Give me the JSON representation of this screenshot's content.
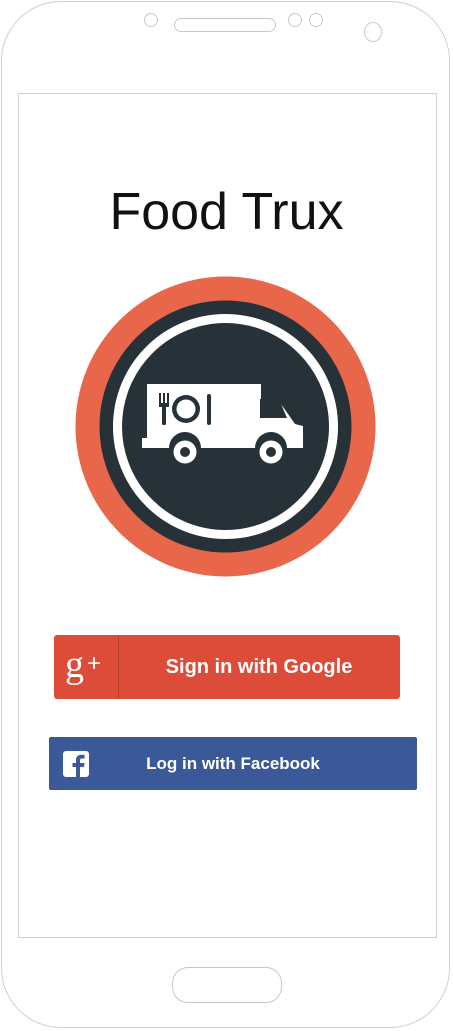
{
  "app": {
    "title": "Food Trux"
  },
  "colors": {
    "logo_ring": "#e8674b",
    "logo_dark": "#263238",
    "google_red": "#dd4b39",
    "facebook_blue": "#3b5998"
  },
  "logo": {
    "icon": "food-truck-icon"
  },
  "auth": {
    "google": {
      "label": "Sign in with Google",
      "icon": "google-plus-icon"
    },
    "facebook": {
      "label": "Log in with Facebook",
      "icon": "facebook-icon"
    }
  }
}
